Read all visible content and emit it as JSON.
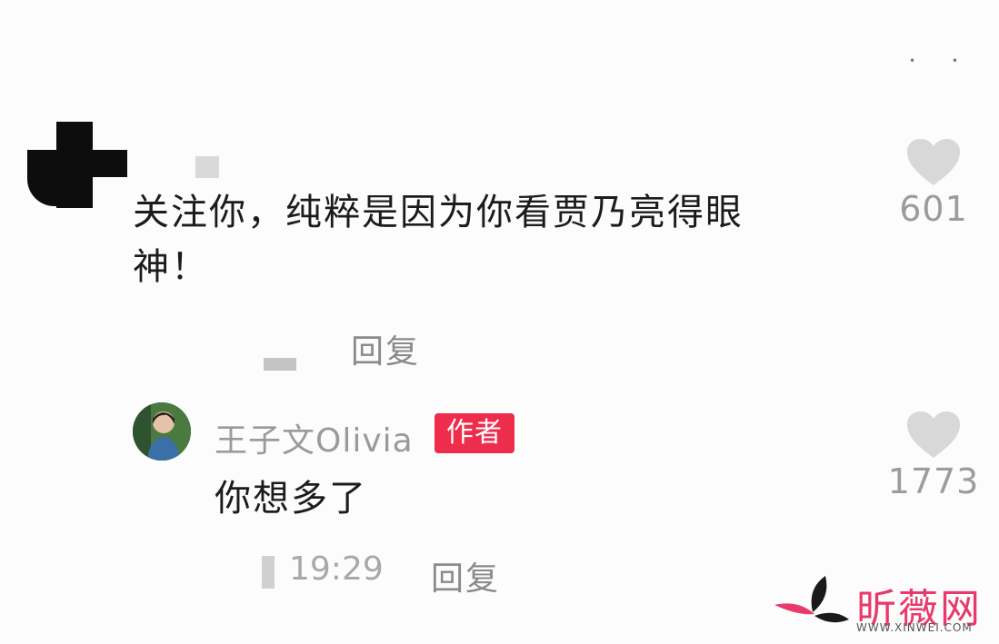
{
  "comments": [
    {
      "text_line1": "关注你，纯粹是因为你看贾乃亮得眼",
      "text_line2": "神！",
      "reply_label": "回复",
      "like_count": "601"
    },
    {
      "username": "王子文Olivia",
      "badge": "作者",
      "text": "你想多了",
      "time": "19:29",
      "reply_label": "回复",
      "like_count": "1773"
    }
  ],
  "watermark": {
    "brand": "昕薇网",
    "sub": "WWW.XINWEI.COM"
  },
  "colors": {
    "badge_bg": "#ee2c4c",
    "watermark": "#e9396b",
    "heart": "#d8d8d8"
  },
  "icons": {
    "like": "heart-icon"
  }
}
